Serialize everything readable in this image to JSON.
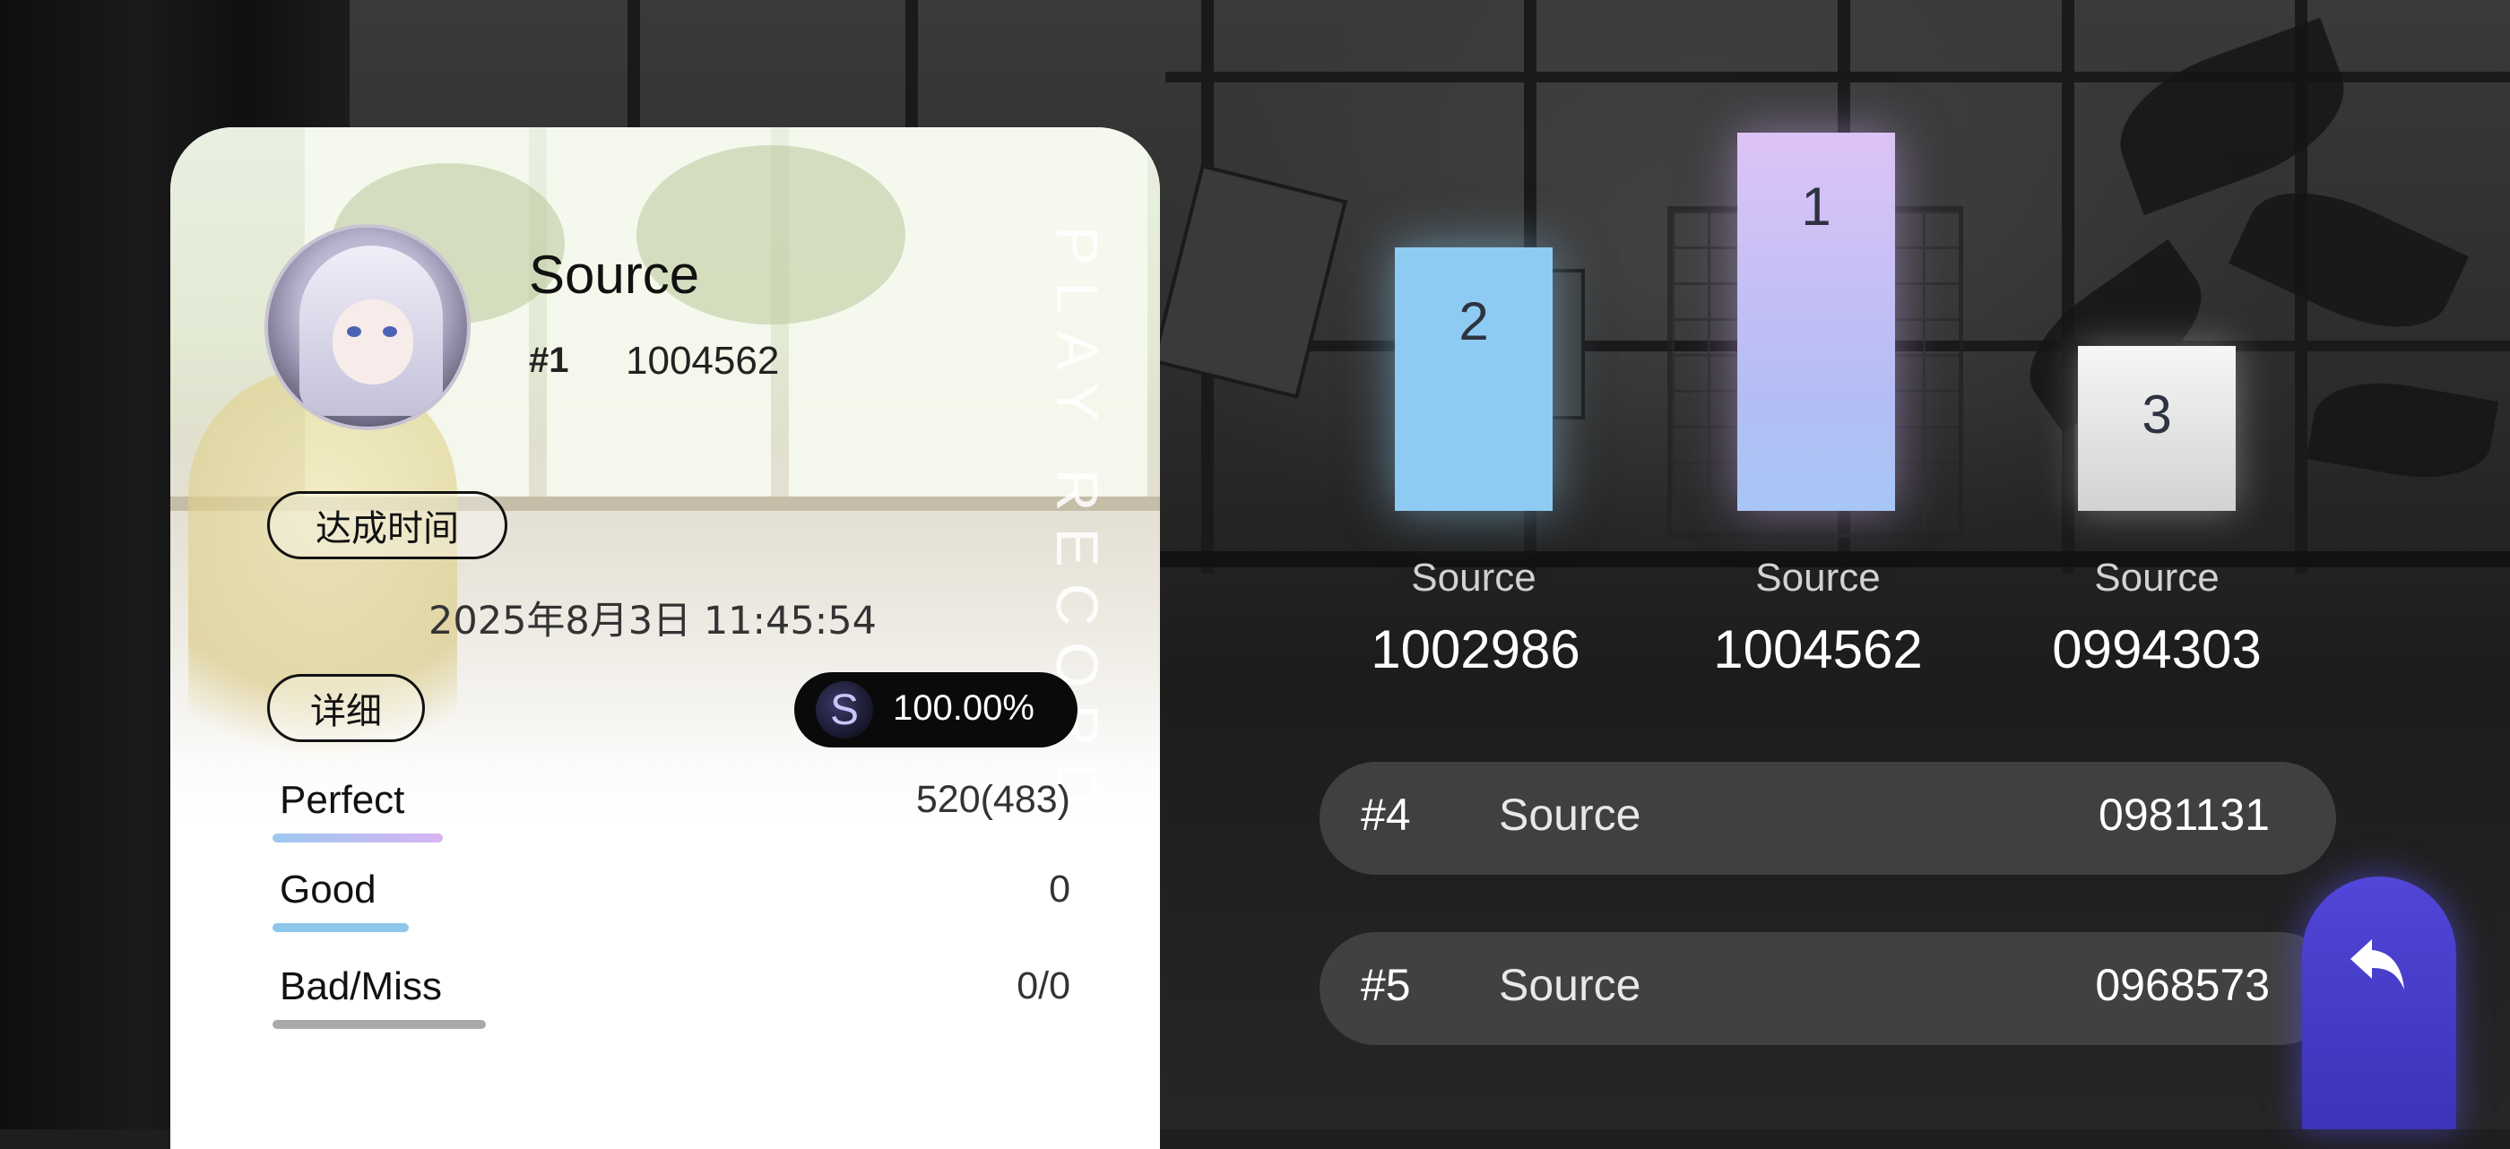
{
  "player": {
    "name": "Source",
    "rank": "#1",
    "score": "1004562"
  },
  "card": {
    "vertical_title": "PLAY RECORD",
    "time_label": "达成时间",
    "time_value": "2025年8月3日 11:45:54",
    "detail_label": "详细",
    "grade": "S",
    "accuracy": "100.00%"
  },
  "judgements": [
    {
      "label": "Perfect",
      "value": "520(483)"
    },
    {
      "label": "Good",
      "value": "0"
    },
    {
      "label": "Bad/Miss",
      "value": "0/0"
    }
  ],
  "podium": [
    {
      "rank": "2",
      "name": "Source",
      "score": "1002986"
    },
    {
      "rank": "1",
      "name": "Source",
      "score": "1004562"
    },
    {
      "rank": "3",
      "name": "Source",
      "score": "0994303"
    }
  ],
  "leaderboard": [
    {
      "rank": "#4",
      "name": "Source",
      "score": "0981131"
    },
    {
      "rank": "#5",
      "name": "Source",
      "score": "0968573"
    }
  ],
  "icons": {
    "back": "back-arrow-icon",
    "grade": "grade-s-icon"
  },
  "colors": {
    "back_button": "#4a40cc",
    "podium_1": "#d9c2f5",
    "podium_2": "#8ecbf2",
    "podium_3": "#f0f0f0"
  }
}
